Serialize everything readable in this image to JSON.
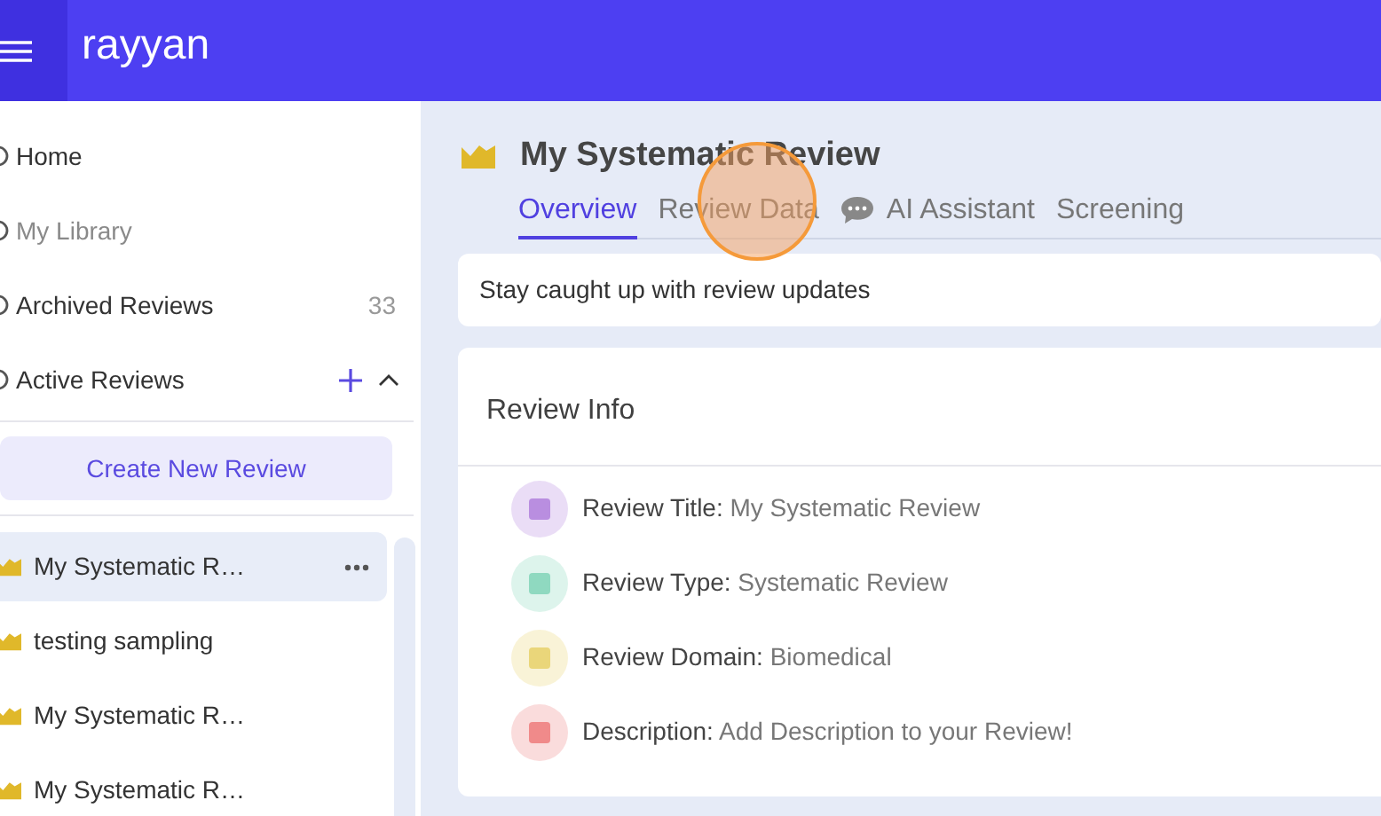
{
  "header": {
    "logo": "rayyan"
  },
  "sidebar": {
    "nav": [
      {
        "label": "Home",
        "disabled": false
      },
      {
        "label": "My Library",
        "disabled": true
      },
      {
        "label": "Archived Reviews",
        "disabled": false,
        "count": "33"
      }
    ],
    "section": {
      "label": "Active Reviews",
      "expanded": true
    },
    "create_button": "Create New Review",
    "reviews": [
      {
        "label": "My Systematic R…",
        "selected": true
      },
      {
        "label": "testing sampling",
        "selected": false
      },
      {
        "label": "My Systematic R…",
        "selected": false
      },
      {
        "label": "My Systematic R…",
        "selected": false
      }
    ]
  },
  "main": {
    "title": "My Systematic Review",
    "tabs": [
      {
        "label": "Overview",
        "selected": true
      },
      {
        "label": "Review Data",
        "selected": false
      },
      {
        "label": "AI Assistant",
        "selected": false,
        "kind": "chat"
      },
      {
        "label": "Screening",
        "selected": false
      }
    ],
    "updates": "Stay caught up with review updates",
    "info": {
      "title": "Review Info",
      "rows": [
        {
          "label": "Review Title:",
          "value": "My Systematic Review",
          "color": "#b98ee0"
        },
        {
          "label": "Review Type:",
          "value": "Systematic Review",
          "color": "#8fd9c0"
        },
        {
          "label": "Review Domain:",
          "value": "Biomedical",
          "color": "#ead67a"
        },
        {
          "label": "Description:",
          "value": "Add Description to your Review!",
          "color": "#f08a8a"
        }
      ]
    }
  }
}
